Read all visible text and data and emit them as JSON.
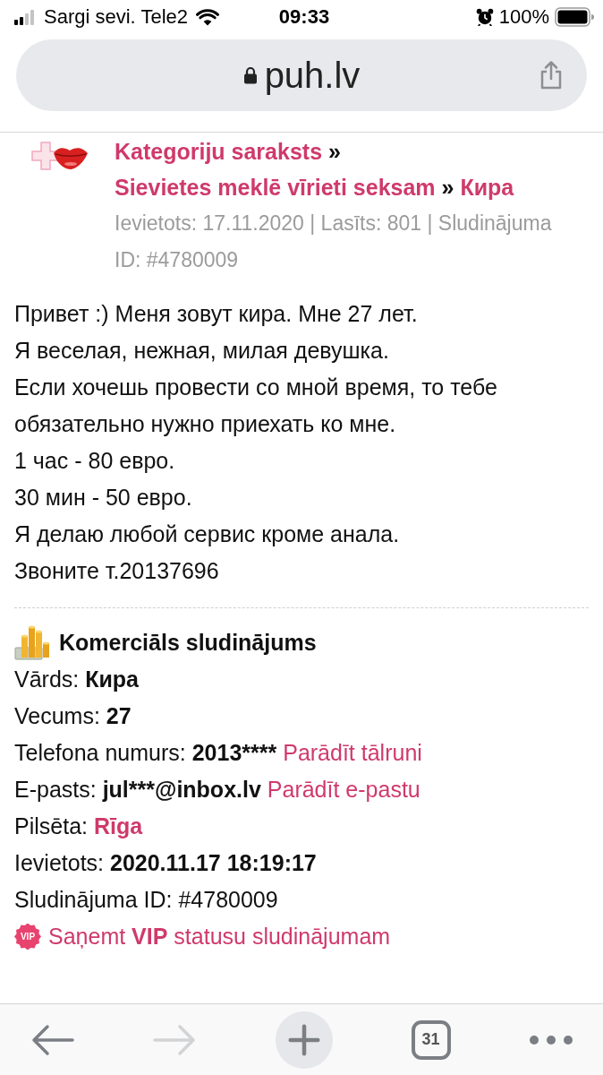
{
  "status_bar": {
    "carrier": "Sargi sevi. Tele2",
    "time": "09:33",
    "battery": "100%"
  },
  "address_bar": {
    "url": "puh.lv"
  },
  "breadcrumb": [
    {
      "kind": "link",
      "label": "Kategoriju saraksts"
    },
    {
      "kind": "separator",
      "label": "»"
    },
    {
      "kind": "link",
      "label": "Sievietes meklē vīrieti seksam"
    },
    {
      "kind": "separator",
      "label": "»"
    },
    {
      "kind": "link",
      "label": "Кира"
    }
  ],
  "meta": "Ievietots: 17.11.2020 | Lasīts: 801 | Sludinājuma ID: #4780009",
  "ad_text": [
    "Привет :) Меня зовут кира. Мне 27 лет.",
    "Я веселая, нежная, милая девушка.",
    "Если хочешь провести со мной время, то тебе обязательно нужно приехать ко мне.",
    "1 час - 80 евро.",
    "30 мин - 50 евро.",
    "Я делаю любой сервис кроме анала.",
    "Звоните т.20137696"
  ],
  "details": {
    "title": "Komerciāls sludinājums",
    "rows": [
      {
        "kind": "bold",
        "label": "Vārds:",
        "value": "Кира"
      },
      {
        "kind": "bold",
        "label": "Vecums:",
        "value": "27"
      },
      {
        "kind": "bold",
        "label": "Telefona numurs:",
        "value": "2013****",
        "action": "Parādīt tālruni"
      },
      {
        "kind": "bold",
        "label": "E-pasts:",
        "value": "jul***@inbox.lv",
        "action": "Parādīt e-pastu"
      },
      {
        "kind": "link",
        "label": "Pilsēta:",
        "value": "Rīga"
      },
      {
        "kind": "bold",
        "label": "Ievietots:",
        "value": "2020.11.17 18:19:17"
      },
      {
        "kind": "plain",
        "label": "Sludinājuma ID:",
        "value": "#4780009"
      }
    ],
    "vip": {
      "badge": "VIP",
      "link": "Saņemt **VIP** statusu sludinājumam"
    }
  },
  "toolbar": {
    "back": {
      "disabled": false
    },
    "forward": {
      "disabled": true
    },
    "tab_count": "31"
  }
}
